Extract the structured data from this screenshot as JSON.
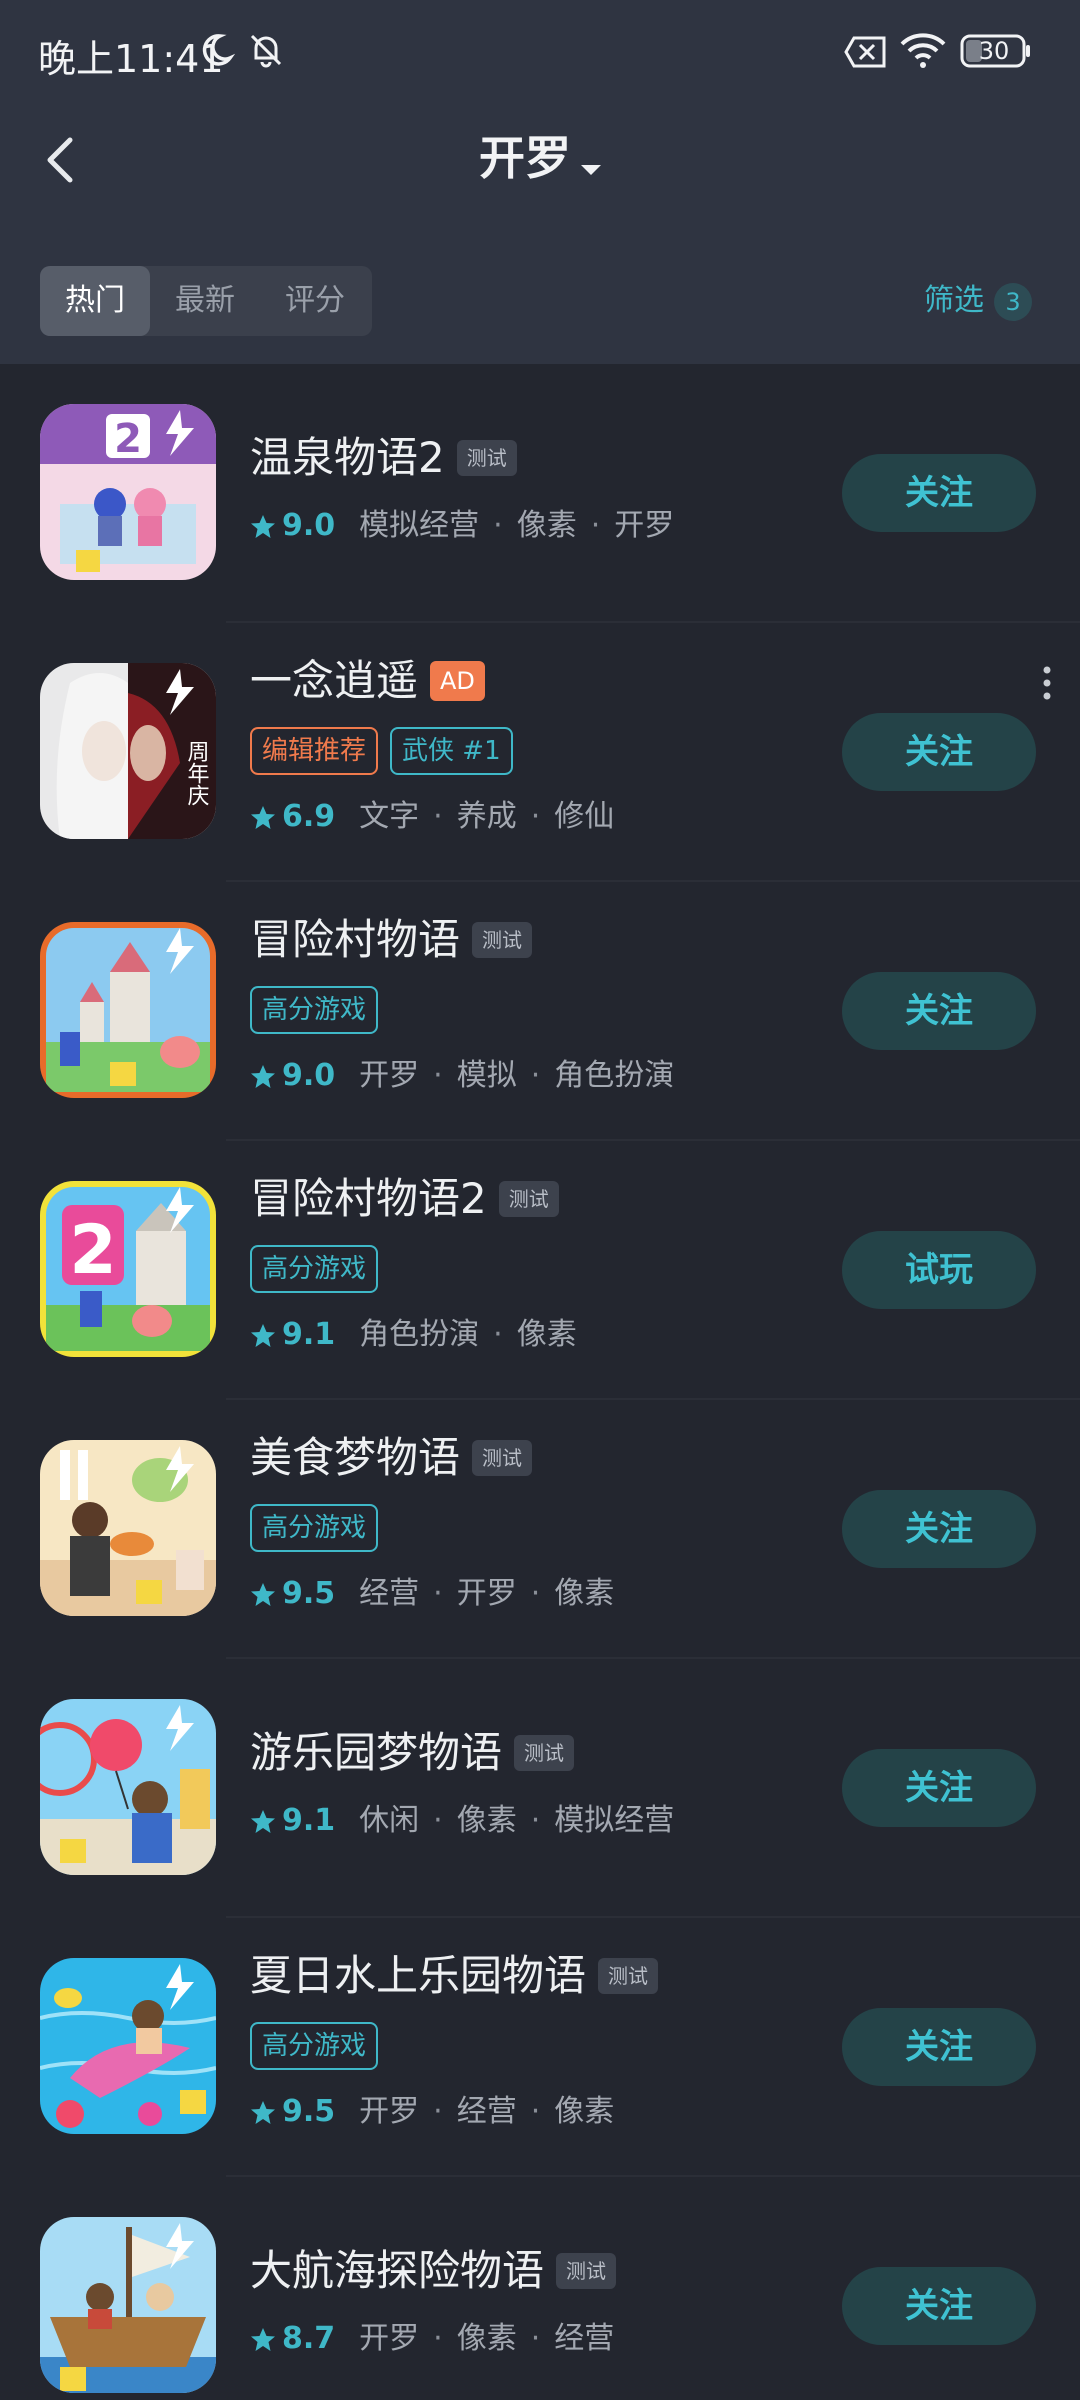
{
  "status_bar": {
    "time": "晚上11:41",
    "battery": "30"
  },
  "header": {
    "title": "开罗"
  },
  "tabs": [
    {
      "label": "热门",
      "active": true
    },
    {
      "label": "最新",
      "active": false
    },
    {
      "label": "评分",
      "active": false
    }
  ],
  "filter": {
    "label": "筛选",
    "count": "3"
  },
  "colors": {
    "accent": "#3fb8c8",
    "ad": "#f07a4c",
    "button_bg": "#244348"
  },
  "games": [
    {
      "name": "温泉物语2",
      "badge": "测试",
      "tags": [],
      "rating": "9.0",
      "genres": [
        "模拟经营",
        "像素",
        "开罗"
      ],
      "button": "关注",
      "icon": "hot-spring-icon"
    },
    {
      "name": "一念逍遥",
      "badge": "AD",
      "tags": [
        {
          "text": "编辑推荐",
          "style": "orange"
        },
        {
          "text": "武侠 #1",
          "style": "cyan"
        }
      ],
      "rating": "6.9",
      "genres": [
        "文字",
        "养成",
        "修仙"
      ],
      "button": "关注",
      "icon": "cultivator-portrait-icon"
    },
    {
      "name": "冒险村物语",
      "badge": "测试",
      "tags": [
        {
          "text": "高分游戏",
          "style": "cyan"
        }
      ],
      "rating": "9.0",
      "genres": [
        "开罗",
        "模拟",
        "角色扮演"
      ],
      "button": "关注",
      "icon": "castle-village-icon"
    },
    {
      "name": "冒险村物语2",
      "badge": "测试",
      "tags": [
        {
          "text": "高分游戏",
          "style": "cyan"
        }
      ],
      "rating": "9.1",
      "genres": [
        "角色扮演",
        "像素"
      ],
      "button": "试玩",
      "icon": "castle-village-2-icon"
    },
    {
      "name": "美食梦物语",
      "badge": "测试",
      "tags": [
        {
          "text": "高分游戏",
          "style": "cyan"
        }
      ],
      "rating": "9.5",
      "genres": [
        "经营",
        "开罗",
        "像素"
      ],
      "button": "关注",
      "icon": "chef-icon"
    },
    {
      "name": "游乐园梦物语",
      "badge": "测试",
      "tags": [],
      "rating": "9.1",
      "genres": [
        "休闲",
        "像素",
        "模拟经营"
      ],
      "button": "关注",
      "icon": "balloon-park-icon"
    },
    {
      "name": "夏日水上乐园物语",
      "badge": "测试",
      "tags": [
        {
          "text": "高分游戏",
          "style": "cyan"
        }
      ],
      "rating": "9.5",
      "genres": [
        "开罗",
        "经营",
        "像素"
      ],
      "button": "关注",
      "icon": "dolphin-pool-icon"
    },
    {
      "name": "大航海探险物语",
      "badge": "测试",
      "tags": [],
      "rating": "8.7",
      "genres": [
        "开罗",
        "像素",
        "经营"
      ],
      "button": "关注",
      "icon": "pirate-ship-icon"
    }
  ]
}
